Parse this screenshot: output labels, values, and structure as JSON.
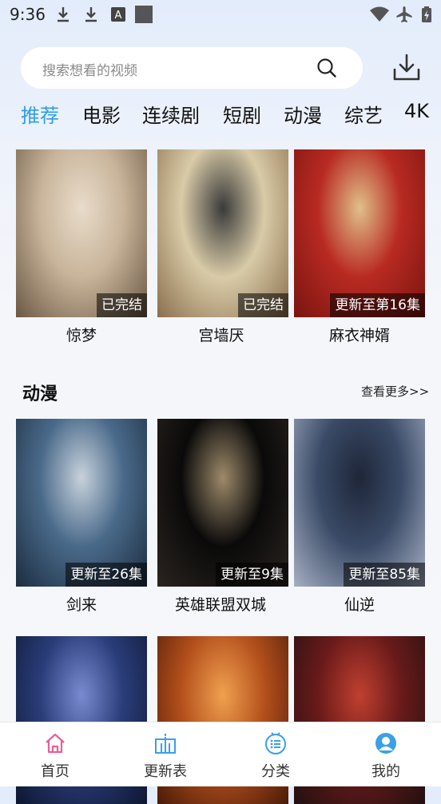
{
  "status_bar": {
    "time": "9:36"
  },
  "search": {
    "placeholder": "搜索想看的视频"
  },
  "tabs": [
    "推荐",
    "电影",
    "连续剧",
    "短剧",
    "动漫",
    "综艺",
    "4K"
  ],
  "active_tab": 0,
  "recommend": [
    {
      "title": "惊梦",
      "badge": "已完结",
      "colors": [
        "#c8b49a",
        "#6b5844",
        "#e9dccb"
      ]
    },
    {
      "title": "宫墙厌",
      "badge": "已完结",
      "colors": [
        "#d9cba8",
        "#8a6f4d",
        "#3a3a3a"
      ]
    },
    {
      "title": "麻衣神婿",
      "badge": "更新至第16集",
      "colors": [
        "#b82a22",
        "#7a1410",
        "#e0c08a"
      ]
    }
  ],
  "anime_section": {
    "title": "动漫",
    "more": "查看更多>>"
  },
  "anime": [
    {
      "title": "剑来",
      "badge": "更新至26集",
      "colors": [
        "#4a6a8a",
        "#1c2d40",
        "#c8d2dc"
      ]
    },
    {
      "title": "英雄联盟双城",
      "badge": "更新至9集",
      "colors": [
        "#0a0a0a",
        "#2a2420",
        "#9d8a6a"
      ]
    },
    {
      "title": "仙逆",
      "badge": "更新至85集",
      "colors": [
        "#3a4a66",
        "#a6b0c4",
        "#1e2638"
      ]
    }
  ],
  "row3": [
    {
      "colors": [
        "#2a3d7a",
        "#0d1630",
        "#7a8ad0"
      ]
    },
    {
      "colors": [
        "#b4501c",
        "#4a1a08",
        "#f0a050"
      ]
    },
    {
      "colors": [
        "#6a1a1a",
        "#201010",
        "#c04030"
      ]
    }
  ],
  "bottom_nav": [
    {
      "label": "首页",
      "icon": "home-icon",
      "color": "#e8609a"
    },
    {
      "label": "更新表",
      "icon": "calendar-icon",
      "color": "#3aa0e8"
    },
    {
      "label": "分类",
      "icon": "category-icon",
      "color": "#3aa0e8"
    },
    {
      "label": "我的",
      "icon": "profile-icon",
      "color": "#3aa0e8"
    }
  ]
}
